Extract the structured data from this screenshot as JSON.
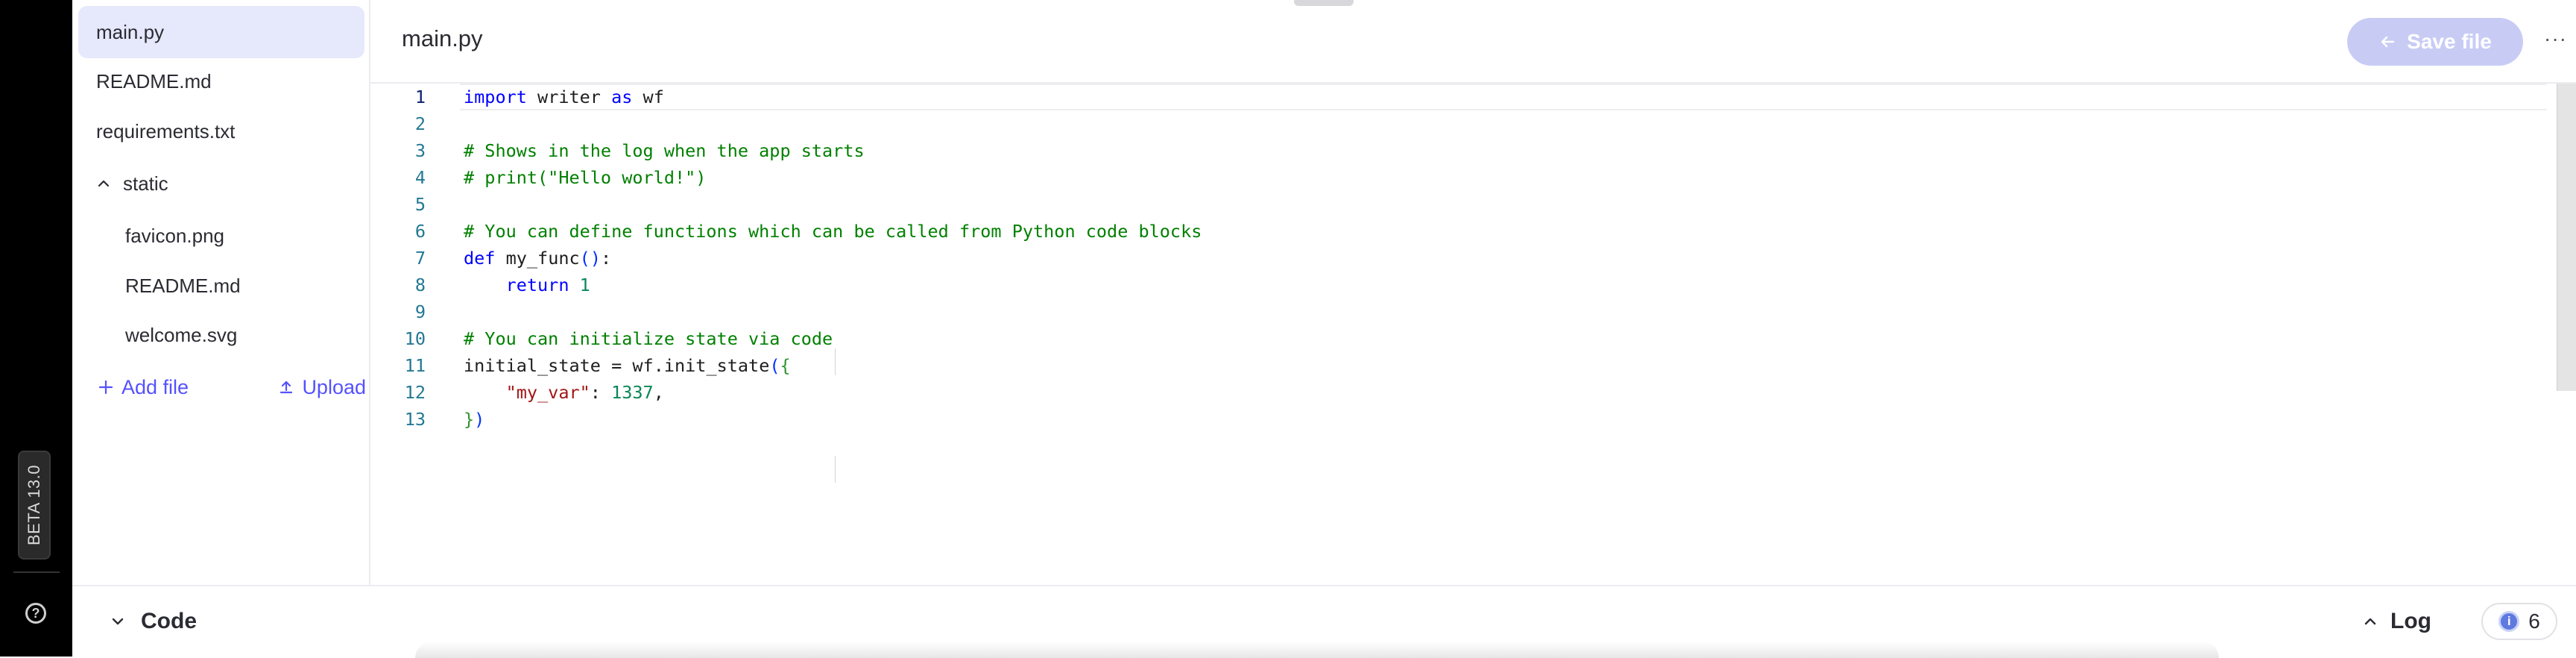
{
  "app": {
    "version_badge": "BETA 13.0",
    "help_icon": "question-circle-icon"
  },
  "sidebar": {
    "files": [
      {
        "label": "main.py",
        "active": true
      },
      {
        "label": "README.md"
      },
      {
        "label": "requirements.txt"
      }
    ],
    "folder": {
      "label": "static",
      "expanded": true,
      "children": [
        {
          "label": "favicon.png"
        },
        {
          "label": "README.md"
        },
        {
          "label": "welcome.svg"
        }
      ]
    },
    "add_file_label": "Add file",
    "upload_label": "Upload"
  },
  "editor": {
    "title": "main.py",
    "save_label": "Save file",
    "save_enabled": false,
    "more_label": "···",
    "active_line": 1,
    "lines": [
      "import writer as wf",
      "",
      "# Shows in the log when the app starts",
      "# print(\"Hello world!\")",
      "",
      "# You can define functions which can be called from Python code blocks",
      "def my_func():",
      "    return 1",
      "",
      "# You can initialize state via code",
      "initial_state = wf.init_state({",
      "    \"my_var\": 1337,",
      "})"
    ]
  },
  "bottom_bar": {
    "code_label": "Code",
    "log_label": "Log",
    "log_count": "6"
  },
  "colors": {
    "accent": "#5551ff",
    "active_file_bg": "#e6e8fb",
    "save_button_disabled": "#c8ccf5"
  }
}
